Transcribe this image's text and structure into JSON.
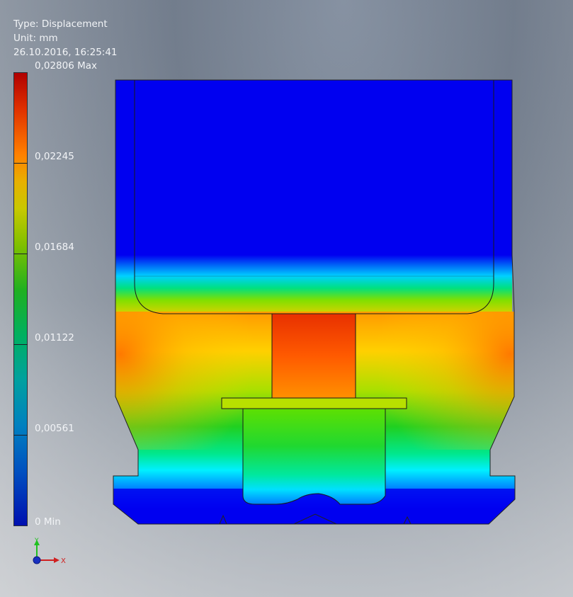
{
  "result_info": {
    "type_line": "Type: Displacement",
    "unit_line": "Unit: mm",
    "timestamp": "26.10.2016, 16:25:41"
  },
  "legend": {
    "labels": [
      {
        "key": "max",
        "text": "0,02806 Max",
        "value": 0.02806
      },
      {
        "key": "l4",
        "text": "0,02245",
        "value": 0.02245
      },
      {
        "key": "l3",
        "text": "0,01684",
        "value": 0.01684
      },
      {
        "key": "l2",
        "text": "0,01122",
        "value": 0.01122
      },
      {
        "key": "l1",
        "text": "0,00561",
        "value": 0.00561
      },
      {
        "key": "min",
        "text": "0 Min",
        "value": 0
      }
    ],
    "colors": [
      "#0000c8",
      "#0060d0",
      "#00b0c0",
      "#00c060",
      "#40c000",
      "#b8c000",
      "#ff9000",
      "#e04000",
      "#b00000"
    ]
  },
  "triad": {
    "y_label": "Y",
    "x_label": "X"
  }
}
